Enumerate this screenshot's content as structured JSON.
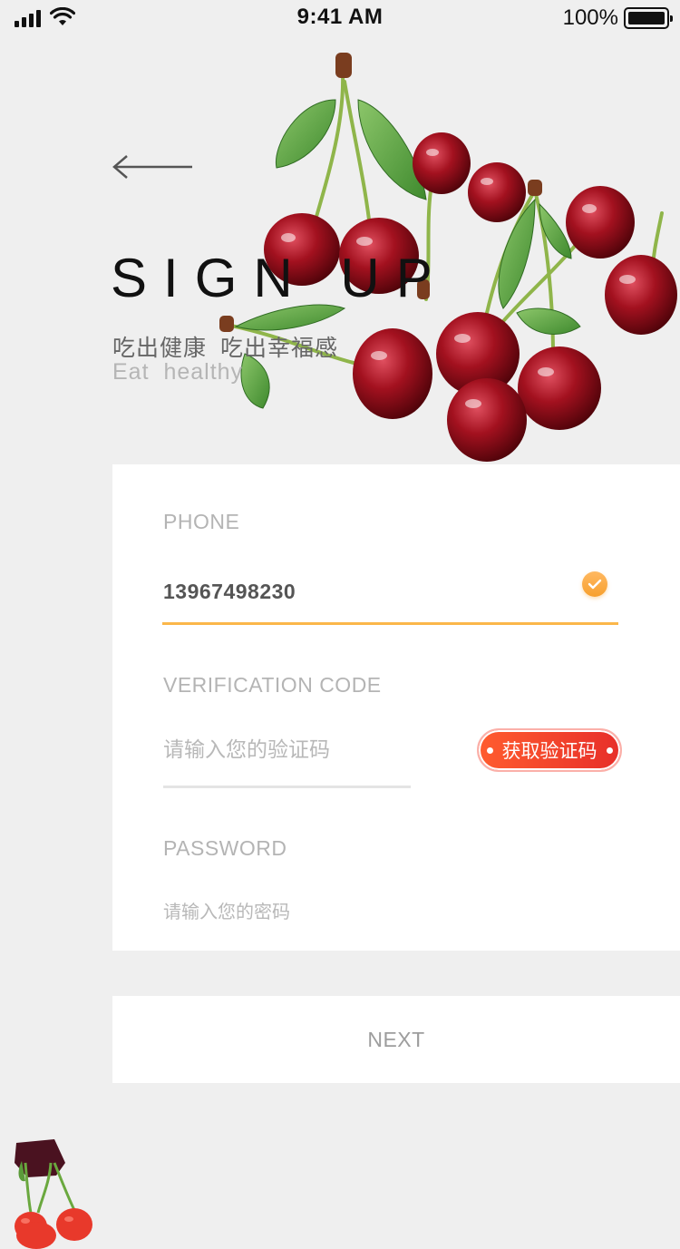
{
  "status_bar": {
    "time": "9:41 AM",
    "battery": "100%"
  },
  "header": {
    "title": "SIGN UP",
    "subtitle_cn": "吃出健康  吃出幸福感",
    "subtitle_en": "Eat  healthy"
  },
  "form": {
    "phone": {
      "label": "PHONE",
      "value": "13967498230"
    },
    "verification": {
      "label": "VERIFICATION CODE",
      "placeholder": "请输入您的验证码",
      "button_label": "获取验证码"
    },
    "password": {
      "label": "PASSWORD",
      "placeholder": "请输入您的密码"
    }
  },
  "next_label": "NEXT",
  "colors": {
    "accent_orange": "#fbb74a",
    "button_red": "#e72f2a",
    "background": "#efefef"
  },
  "icons": [
    "signal-icon",
    "wifi-icon",
    "battery-icon",
    "back-arrow-icon",
    "check-icon",
    "cherries-image"
  ]
}
